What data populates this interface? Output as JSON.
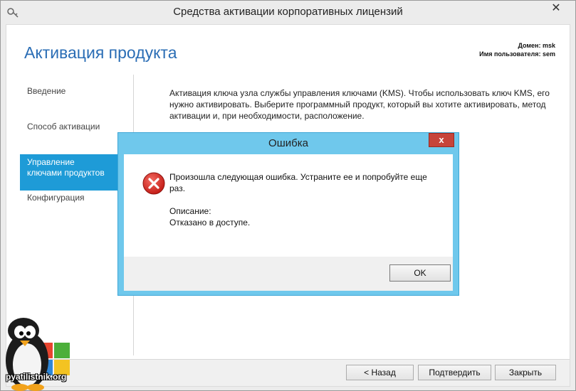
{
  "window": {
    "title": "Средства активации корпоративных лицензий",
    "close_glyph": "✕"
  },
  "page": {
    "title": "Активация продукта",
    "domain_line": "Домен: msk",
    "user_line": "Имя пользователя: sem",
    "description": "Активация ключа узла службы управления ключами (KMS). Чтобы использовать ключ KMS, его нужно активировать. Выберите программный продукт, который вы хотите активировать, метод активации и, при необходимости, расположение."
  },
  "nav": {
    "items": [
      {
        "label": "Введение",
        "active": false
      },
      {
        "label": "Способ активации",
        "active": false
      },
      {
        "label": "Управление ключами продуктов",
        "active": true
      },
      {
        "label": "Конфигурация",
        "active": false
      }
    ]
  },
  "footer": {
    "back_label": "< Назад",
    "commit_label": "Подтвердить",
    "close_label": "Закрыть"
  },
  "dialog": {
    "title": "Ошибка",
    "close_glyph": "x",
    "message": "Произошла следующая ошибка. Устраните ее и попробуйте еще раз.",
    "description_label": "Описание:",
    "description_value": "Отказано в доступе.",
    "ok_label": "OK"
  },
  "watermark": {
    "text": "pyatilistnik.org"
  },
  "colors": {
    "accent": "#1e9bd7",
    "title_blue": "#2a6db5",
    "dialog_frame": "#6fc8ec",
    "dialog_close": "#c7443a",
    "error_red": "#d9302b"
  }
}
